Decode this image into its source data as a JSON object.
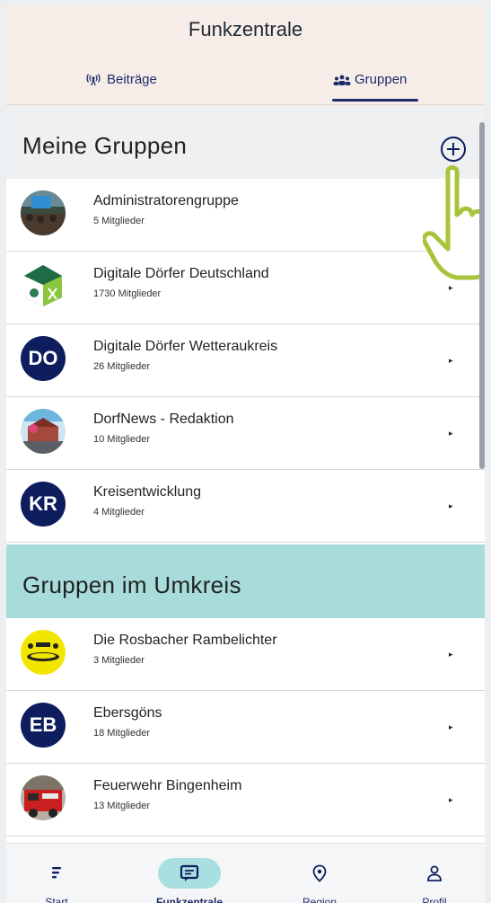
{
  "header": {
    "title": "Funkzentrale",
    "tabs": [
      {
        "label": "Beiträge",
        "icon": "radio-icon"
      },
      {
        "label": "Gruppen",
        "icon": "groups-icon",
        "active": true
      }
    ]
  },
  "my_groups": {
    "title": "Meine Gruppen",
    "add_icon": "plus-circle-icon",
    "items": [
      {
        "name": "Administratorengruppe",
        "members": "5 Mitglieder",
        "avatar": "photo"
      },
      {
        "name": "Digitale Dörfer Deutschland",
        "members": "1730 Mitglieder",
        "avatar": "logo"
      },
      {
        "name": "Digitale Dörfer Wetteraukreis",
        "members": "26 Mitglieder",
        "avatar": "DO"
      },
      {
        "name": "DorfNews - Redaktion",
        "members": "10 Mitglieder",
        "avatar": "photo"
      },
      {
        "name": "Kreisentwicklung",
        "members": "4 Mitglieder",
        "avatar": "KR"
      }
    ]
  },
  "nearby_groups": {
    "title": "Gruppen im Umkreis",
    "items": [
      {
        "name": "Die Rosbacher Rambelichter",
        "members": "3 Mitglieder",
        "avatar": "logo"
      },
      {
        "name": "Ebersgöns",
        "members": "18 Mitglieder",
        "avatar": "EB"
      },
      {
        "name": "Feuerwehr Bingenheim",
        "members": "13 Mitglieder",
        "avatar": "photo"
      }
    ]
  },
  "bottom_nav": [
    {
      "label": "Start",
      "icon": "feed-icon"
    },
    {
      "label": "Funkzentrale",
      "icon": "chat-icon",
      "active": true
    },
    {
      "label": "Region",
      "icon": "location-pin-icon"
    },
    {
      "label": "Profil",
      "icon": "person-icon"
    }
  ],
  "colors": {
    "header_bg": "#f7ede8",
    "accent_navy": "#0e1d5e",
    "section_teal": "#a7dcdb",
    "hand_outline": "#a8c43a"
  }
}
